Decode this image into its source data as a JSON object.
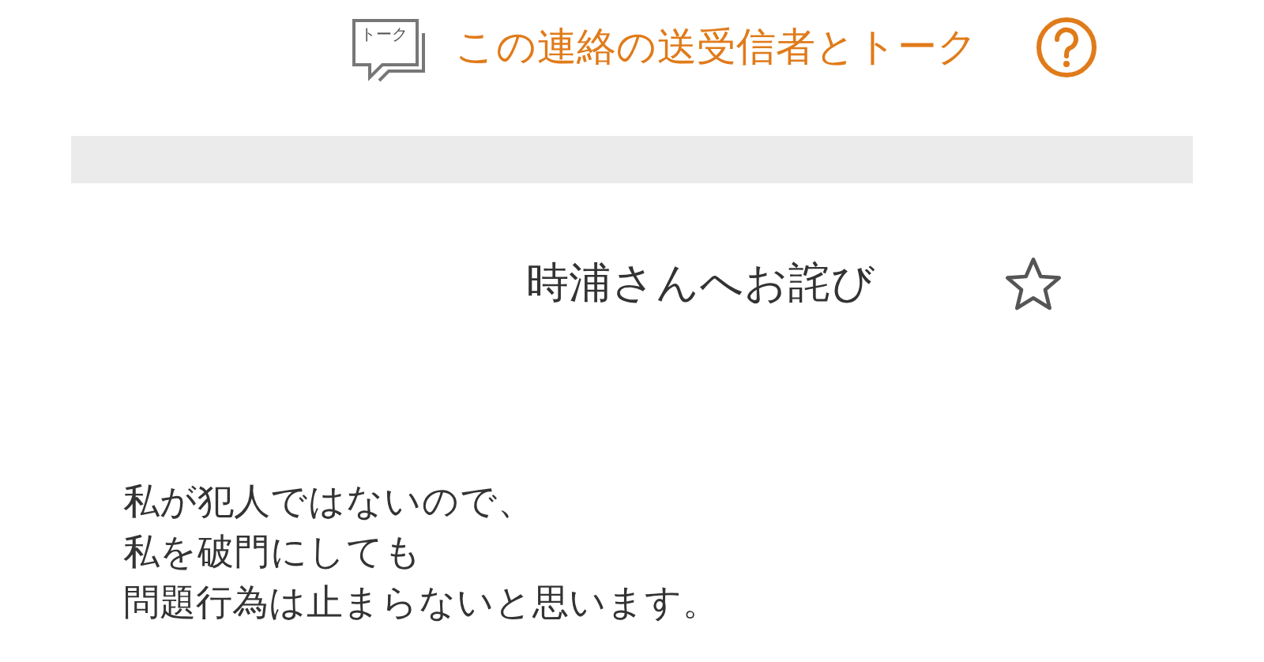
{
  "talk_link": {
    "icon_label": "トーク",
    "label": "この連絡の送受信者とトーク"
  },
  "message": {
    "subject": "時浦さんへお詫び",
    "starred": false,
    "body_lines": [
      "私が犯人ではないので、",
      "私を破門にしても",
      "問題行為は止まらないと思います。"
    ]
  }
}
